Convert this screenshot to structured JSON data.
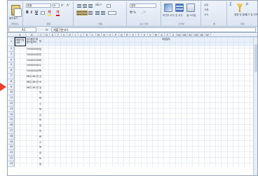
{
  "ribbon": {
    "groups": [
      {
        "label": "클립보드"
      },
      {
        "label": "글꼴"
      },
      {
        "label": "맞춤"
      },
      {
        "label": "표시 형식"
      },
      {
        "label": "스타일"
      },
      {
        "label": "셀"
      },
      {
        "label": "편집"
      }
    ],
    "paste_label": "붙여넣기",
    "font_name": "돋움",
    "font_size": "9",
    "number_format": "일반",
    "buttons": [
      "B",
      "I",
      "U",
      "가",
      "가"
    ],
    "style_labels": [
      "조건부 서식",
      "표 서식",
      "셀 스타일"
    ],
    "cell_labels": [
      "삽입",
      "삭제",
      "서식"
    ],
    "edit_labels": [
      "정렬 및 필터",
      "찾기 및 선택"
    ]
  },
  "formula_bar": {
    "name_box": "A1",
    "fx_label": "fx",
    "formula": "제출구분코드"
  },
  "accent": "#e8402a",
  "columns": [
    "A",
    "B",
    "C",
    "D",
    "E",
    "F",
    "G",
    "H",
    "I",
    "J",
    "K",
    "L",
    "M",
    "N",
    "O",
    "P",
    "Q",
    "R",
    "S",
    "T",
    "U",
    "V",
    "W",
    "X",
    "Y",
    "Z",
    "AA",
    "AB",
    "AC",
    "AD",
    "AE",
    "AF"
  ],
  "header": {
    "a1": "제출구분코드",
    "b1": "유가증권 제출구분코드",
    "c1": "월",
    "group_title": "조업일자"
  },
  "rows": [
    "1",
    "2",
    "3",
    "4",
    "5",
    "6",
    "7",
    "8",
    "9",
    "10",
    "11",
    "12",
    "13",
    "14",
    "15",
    "16",
    "17",
    "18",
    "19",
    "20",
    "21",
    "22",
    "23"
  ],
  "b_values": [
    "Y00000000",
    "Y00000000",
    "Y00000000",
    "Y00000000",
    "Y00000000",
    "KB주-SB-전",
    "KB주-SB-전",
    "KB주-SB-전"
  ],
  "c_values": [
    "일",
    "월",
    "화",
    "수",
    "목",
    "금",
    "토"
  ]
}
